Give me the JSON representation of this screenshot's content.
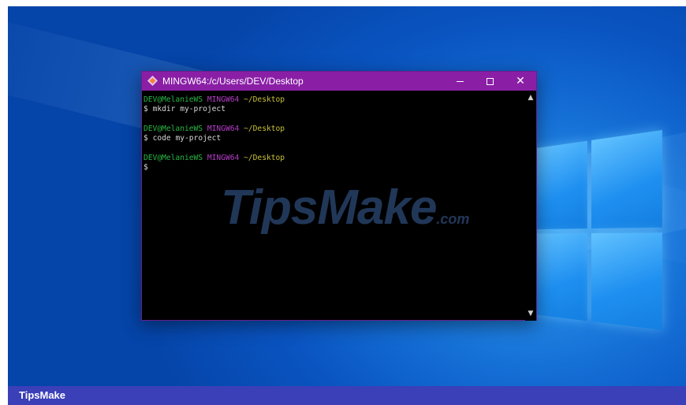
{
  "window": {
    "title": "MINGW64:/c/Users/DEV/Desktop",
    "accent_color": "#8a1fa6",
    "controls": {
      "minimize": "minimize-icon",
      "maximize": "maximize-icon",
      "close": "close-icon"
    }
  },
  "terminal": {
    "prompt_user": "DEV@MelanieWS",
    "prompt_host": "MINGW64",
    "prompt_path": "~/Desktop",
    "prompt_symbol": "$",
    "commands": [
      "mkdir my-project",
      "code my-project",
      ""
    ]
  },
  "watermark": {
    "main": "TipsMake",
    "sub": ".com"
  },
  "footer": {
    "brand": "TipsMake"
  }
}
